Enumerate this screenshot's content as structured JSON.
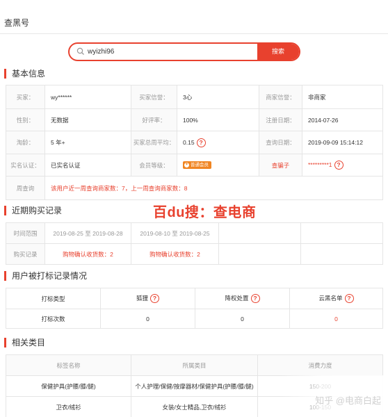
{
  "page": {
    "title": "查黑号"
  },
  "search": {
    "value": "wyizhi96",
    "button_label": "搜索"
  },
  "basic_info": {
    "heading": "基本信息",
    "rows": [
      [
        "买家：",
        "wy******",
        "买家信誉：",
        "3心",
        "商家信誉：",
        "非商家"
      ],
      [
        "性别：",
        "无数据",
        "好评率：",
        "100%",
        "注册日期：",
        "2014-07-26"
      ],
      [
        "淘龄：",
        "5 年+",
        "买家总周平均：",
        "0.15",
        "查询日期：",
        "2019-09-09 15:14:12"
      ],
      [
        "实名认证：",
        "已实名认证",
        "会员等级：",
        "普通会员",
        "查骗子",
        "*********1"
      ],
      [
        "周查询",
        "该用户近一周查询商家数：7，上一周查询商家数：8"
      ]
    ]
  },
  "recent_purchase": {
    "heading": "近期购买记录",
    "rows": [
      [
        "时间范围",
        "2019-08-25 至 2019-08-28",
        "2019-08-10 至 2019-08-25",
        "",
        ""
      ],
      [
        "购买记录",
        "购物确认收货数：2",
        "购物确认收货数：2",
        "",
        ""
      ]
    ]
  },
  "mark_records": {
    "heading": "用户被打标记录情况",
    "headers": [
      "打标类型",
      "狐狸",
      "降权处置",
      "云黑名单"
    ],
    "rows": [
      [
        "打标次数",
        "0",
        "0",
        "0"
      ]
    ]
  },
  "categories": {
    "heading": "相关类目",
    "headers": [
      "标签名称",
      "所属类目",
      "消费力度"
    ],
    "rows": [
      [
        "保健护具(护腰/膝/腿)",
        "个人护理/保健/按摩器材/保健护具(护腰/膝/腿)",
        "150-200"
      ],
      [
        "卫衣/绒衫",
        "女装/女士精品,卫衣/绒衫",
        "100-150"
      ]
    ]
  },
  "watermarks": {
    "baidu": "百du搜：查电商",
    "zhihu": "知乎 @电商白起"
  },
  "colors": {
    "accent": "#e8412e",
    "badge": "#f08522"
  },
  "icons": {
    "help": "question-circle-icon",
    "search": "search-icon",
    "vip": "crown-badge-icon"
  }
}
